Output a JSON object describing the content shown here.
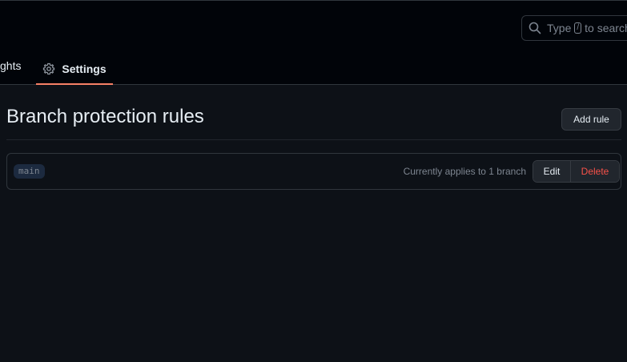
{
  "header": {
    "search": {
      "prefix": "Type",
      "key": "/",
      "suffix": "to search",
      "icon": "search-icon"
    }
  },
  "nav": {
    "partial_tab_label": "ghts",
    "active_tab": {
      "label": "Settings",
      "icon": "gear-icon"
    }
  },
  "main": {
    "title": "Branch protection rules",
    "add_rule_label": "Add rule",
    "rules": [
      {
        "branch": "main",
        "applies_text": "Currently applies to 1 branch",
        "edit_label": "Edit",
        "delete_label": "Delete"
      }
    ]
  },
  "colors": {
    "accent_underline": "#f78166",
    "danger": "#f85149",
    "background": "#0d1117"
  }
}
